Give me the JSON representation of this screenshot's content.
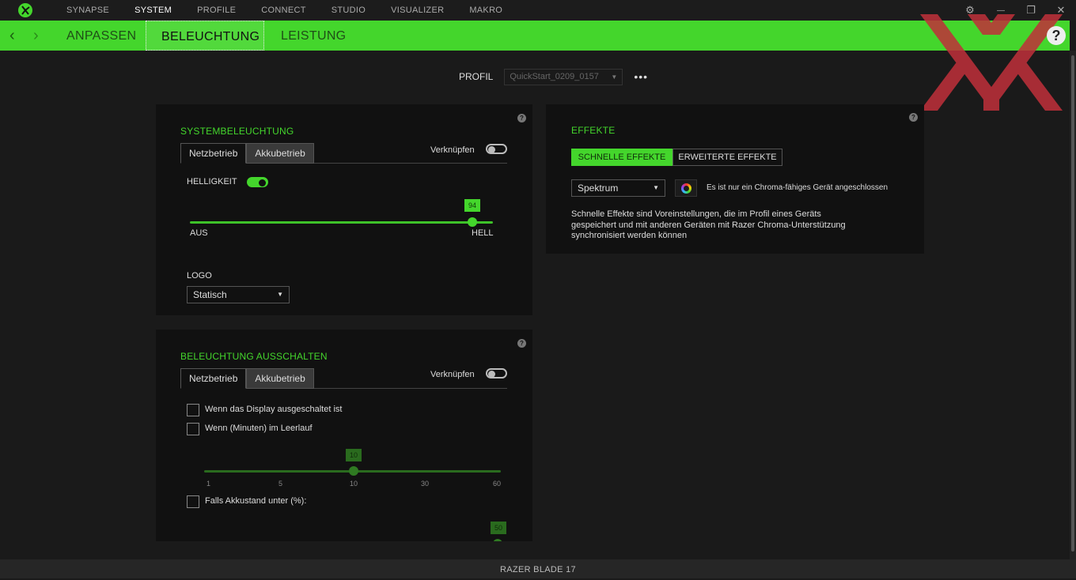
{
  "topnav": {
    "items": [
      "SYNAPSE",
      "SYSTEM",
      "PROFILE",
      "CONNECT",
      "STUDIO",
      "VISUALIZER",
      "MAKRO"
    ],
    "active": "SYSTEM"
  },
  "window": {
    "settings_glyph": "⚙",
    "minimize_glyph": "—",
    "restore_glyph": "❐",
    "close_glyph": "✕"
  },
  "subnav": {
    "back_glyph": "‹",
    "forward_glyph": "›",
    "tabs": [
      "ANPASSEN",
      "BELEUCHTUNG",
      "LEISTUNG"
    ],
    "active": "BELEUCHTUNG",
    "help_glyph": "?"
  },
  "profile": {
    "label": "PROFIL",
    "value": "QuickStart_0209_0157",
    "more": "•••"
  },
  "system_lighting": {
    "title": "SYSTEMBELEUCHTUNG",
    "tabs": [
      "Netzbetrieb",
      "Akkubetrieb"
    ],
    "active_tab": "Netzbetrieb",
    "link_label": "Verknüpfen",
    "link_on": false,
    "brightness_label": "HELLIGKEIT",
    "brightness_on": true,
    "brightness_value": "94",
    "brightness_percent": 94,
    "min_label": "AUS",
    "max_label": "HELL",
    "logo_label": "LOGO",
    "logo_value": "Statisch"
  },
  "lighting_off": {
    "title": "BELEUCHTUNG AUSSCHALTEN",
    "tabs": [
      "Netzbetrieb",
      "Akkubetrieb"
    ],
    "active_tab": "Netzbetrieb",
    "link_label": "Verknüpfen",
    "link_on": false,
    "display_off_label": "Wenn das Display ausgeschaltet ist",
    "idle_label": "Wenn (Minuten) im Leerlauf",
    "idle_value": "10",
    "idle_ticks": [
      "1",
      "5",
      "10",
      "30",
      "60"
    ],
    "battery_label": "Falls Akkustand unter (%):",
    "battery_value": "50"
  },
  "effects": {
    "title": "EFFEKTE",
    "quick_label": "SCHNELLE EFFEKTE",
    "advanced_label": "ERWEITERTE EFFEKTE",
    "effect_value": "Spektrum",
    "note": "Es ist nur ein Chroma-fähiges Gerät angeschlossen",
    "desc_line1": "Schnelle Effekte sind Voreinstellungen, die im Profil eines Geräts",
    "desc_line2": "gespeichert und mit anderen Geräten mit Razer Chroma-Unterstützung",
    "desc_line3": "synchronisiert werden können"
  },
  "status": {
    "device": "RAZER BLADE 17"
  },
  "colors": {
    "accent": "#44d62c",
    "background": "#1a1a1a",
    "panel": "#111111"
  }
}
